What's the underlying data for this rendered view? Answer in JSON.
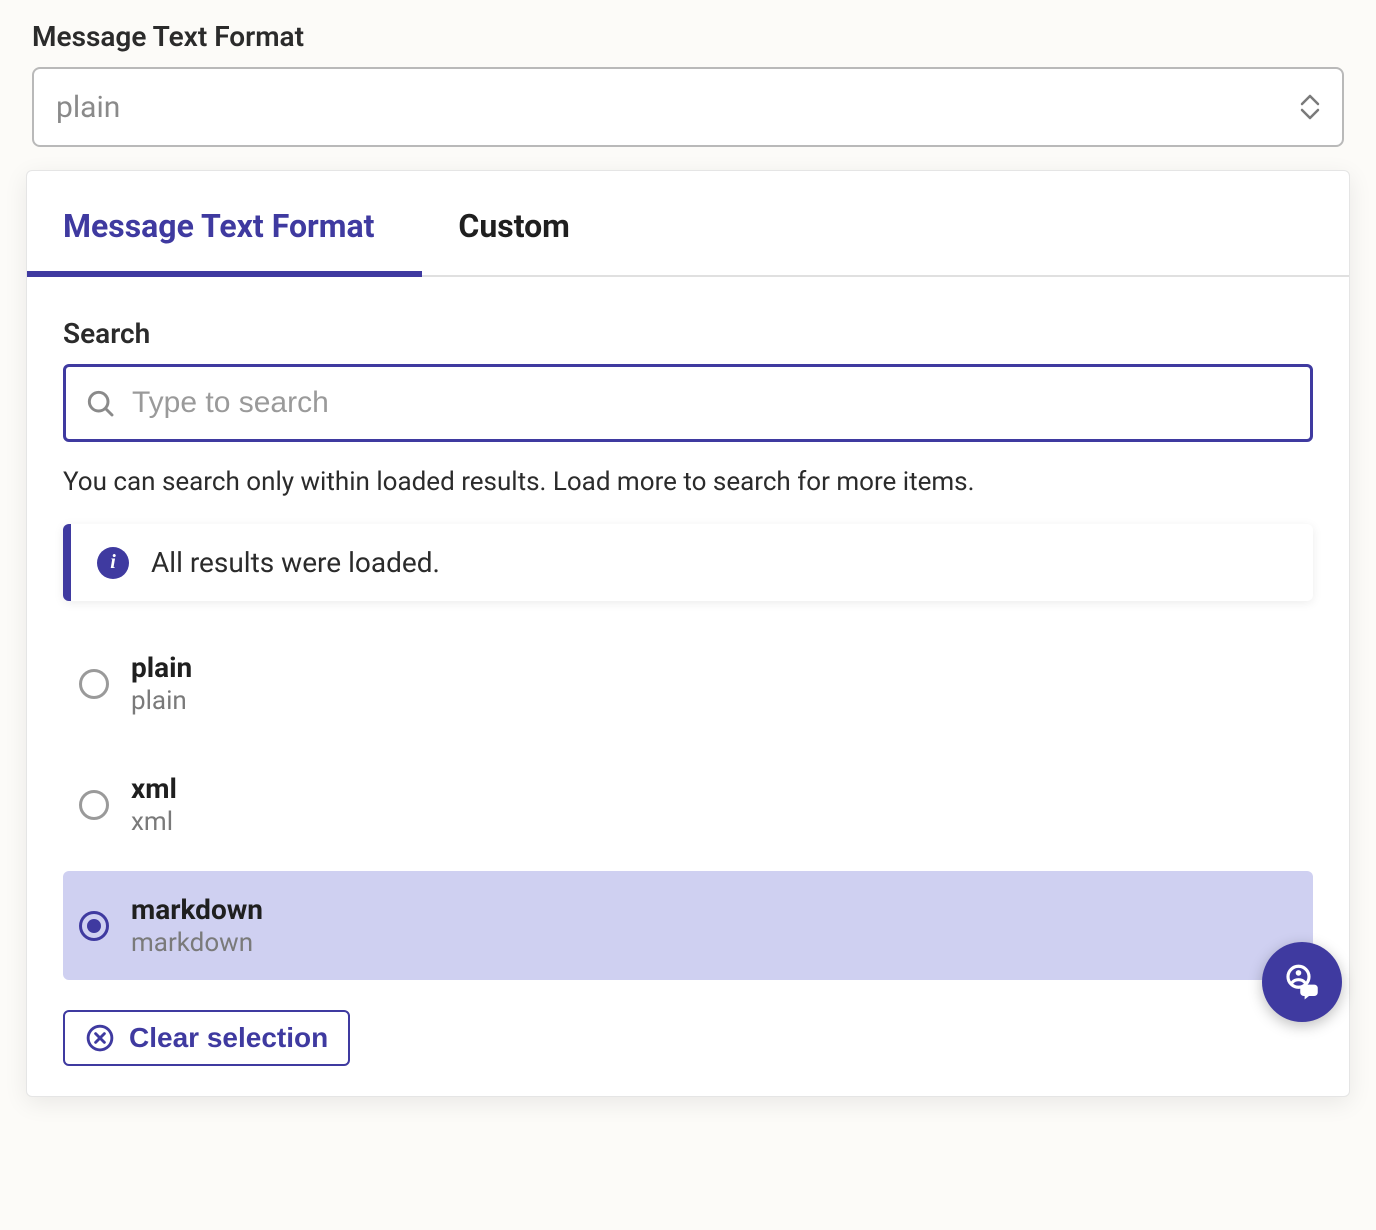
{
  "field": {
    "label": "Message Text Format",
    "value": "plain"
  },
  "tabs": [
    {
      "label": "Message Text Format",
      "active": true
    },
    {
      "label": "Custom",
      "active": false
    }
  ],
  "search": {
    "label": "Search",
    "placeholder": "Type to search",
    "value": "",
    "hint": "You can search only within loaded results. Load more to search for more items."
  },
  "info_banner": {
    "text": "All results were loaded."
  },
  "options": [
    {
      "title": "plain",
      "subtitle": "plain",
      "selected": false
    },
    {
      "title": "xml",
      "subtitle": "xml",
      "selected": false
    },
    {
      "title": "markdown",
      "subtitle": "markdown",
      "selected": true
    }
  ],
  "clear_button": {
    "label": "Clear selection"
  },
  "colors": {
    "accent": "#3f3aa0",
    "selection_bg": "#cfd0f1"
  }
}
